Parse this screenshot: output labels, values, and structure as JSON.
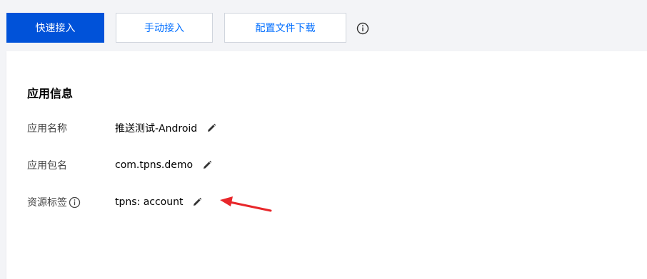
{
  "toolbar": {
    "quick_access_label": "快速接入",
    "manual_access_label": "手动接入",
    "config_download_label": "配置文件下载"
  },
  "app_info": {
    "title": "应用信息",
    "fields": [
      {
        "label": "应用名称",
        "value": "推送测试-Android"
      },
      {
        "label": "应用包名",
        "value": "com.tpns.demo"
      },
      {
        "label": "资源标签",
        "value": "tpns: account"
      }
    ]
  },
  "icons": {
    "info": "info-circle-icon",
    "edit": "pencil-icon",
    "annotation": "red-arrow"
  },
  "colors": {
    "primary": "#0052d9",
    "link": "#006eff",
    "annotation": "#e8262a"
  }
}
